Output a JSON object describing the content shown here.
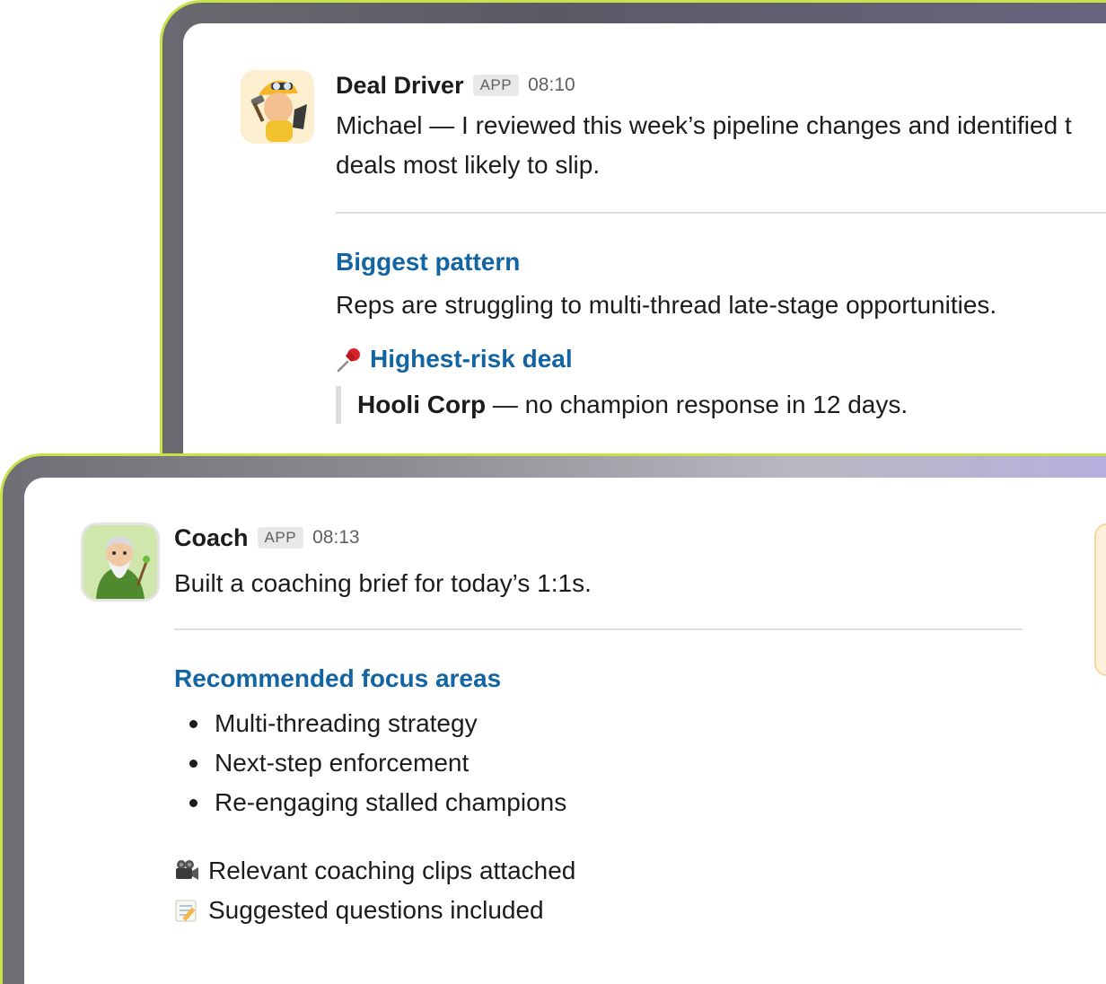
{
  "deal_message": {
    "sender": "Deal Driver",
    "badge": "APP",
    "time": "08:10",
    "intro_line1": "Michael — I reviewed this week’s pipeline changes and identified t",
    "intro_line2": "deals most likely to slip.",
    "pattern_title": "Biggest pattern",
    "pattern_text": "Reps are struggling to multi-thread late-stage opportunities.",
    "risk_title": "Highest-risk deal",
    "risk_company": "Hooli Corp",
    "risk_detail": " — no champion response in 12 days."
  },
  "coach_message": {
    "sender": "Coach",
    "badge": "APP",
    "time": "08:13",
    "intro": "Built a coaching brief for today’s 1:1s.",
    "focus_title": "Recommended focus areas",
    "focus_items": [
      "Multi-threading strategy",
      "Next-step enforcement",
      "Re-engaging stalled champions"
    ],
    "clips_text": "Relevant coaching clips attached",
    "questions_text": "Suggested questions included"
  },
  "icons": {
    "pin": "pushpin-icon",
    "camera": "movie-camera-icon",
    "memo": "memo-icon"
  },
  "colors": {
    "link_blue": "#1264a3",
    "frame_accent": "#c6e34a"
  }
}
